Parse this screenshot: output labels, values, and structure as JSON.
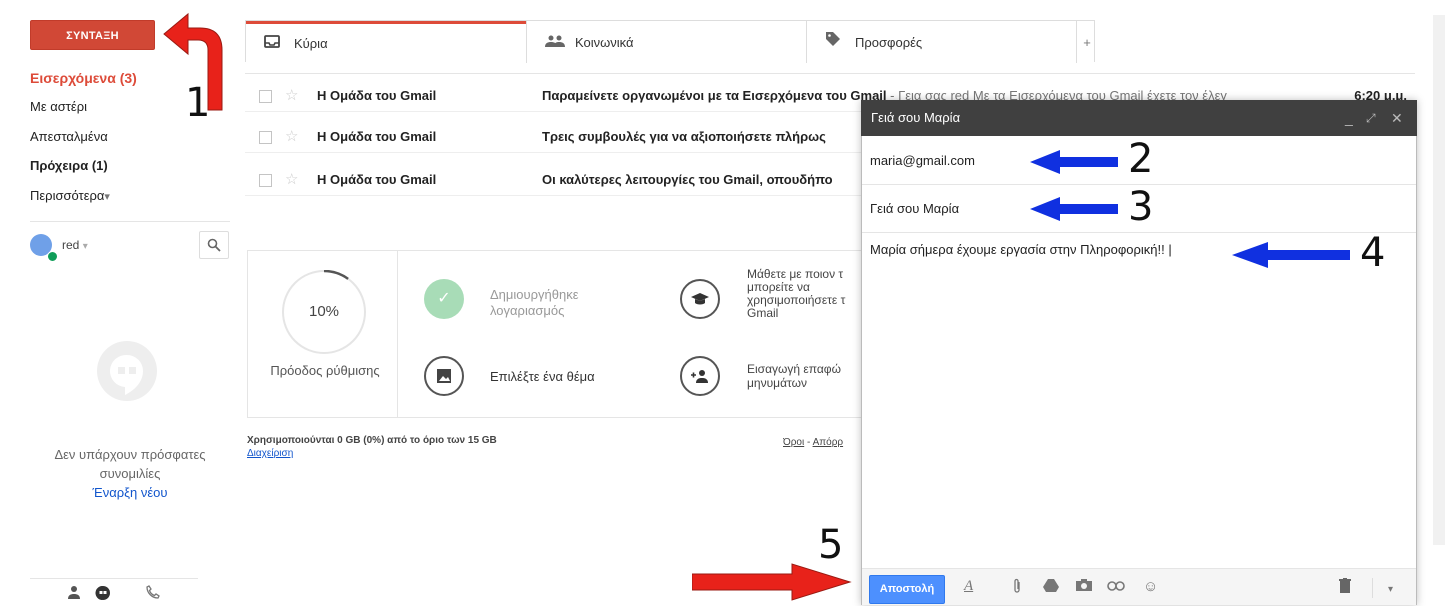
{
  "sidebar": {
    "compose_label": "ΣΥΝΤΑΞΗ",
    "items": [
      {
        "label": "Εισερχόμενα (3)"
      },
      {
        "label": "Με αστέρι"
      },
      {
        "label": "Απεσταλμένα"
      },
      {
        "label": "Πρόχειρα (1)"
      },
      {
        "label": "Περισσότερα"
      }
    ],
    "more_caret": "▾",
    "user": {
      "name": "red",
      "caret": "▾"
    },
    "no_conversations": "Δεν υπάρχουν πρόσφατες συνομιλίες",
    "new_conversation": "Έναρξη νέου"
  },
  "tabs": [
    {
      "label": "Κύρια",
      "icon": "inbox-icon"
    },
    {
      "label": "Κοινωνικά",
      "icon": "people-icon"
    },
    {
      "label": "Προσφορές",
      "icon": "tag-icon"
    },
    {
      "label": "+"
    }
  ],
  "emails": [
    {
      "sender": "Η Ομάδα του Gmail",
      "subject": "Παραμείνετε οργανωμένοι με τα Εισερχόμενα του Gmail",
      "snippet": " - Γεια σας red Με τα Εισερχόμενα του Gmail έχετε τον έλεγ",
      "time": "6:20 μ.μ."
    },
    {
      "sender": "Η Ομάδα του Gmail",
      "subject": "Τρεις συμβουλές για να αξιοποιήσετε πλήρως",
      "snippet": "",
      "time": ""
    },
    {
      "sender": "Η Ομάδα του Gmail",
      "subject": "Οι καλύτερες λειτουργίες του Gmail, οπουδήπο",
      "snippet": "",
      "time": ""
    }
  ],
  "setup": {
    "progress": 0.1,
    "progress_text": "10%",
    "progress_label": "Πρόοδος ρύθμισης",
    "steps": [
      {
        "label": "Δημιουργήθηκε λογαριασμός",
        "icon": "check-icon",
        "done": true
      },
      {
        "label": "Επιλέξτε ένα θέμα",
        "icon": "image-icon",
        "done": false
      },
      {
        "label": "Μάθετε με ποιον τ μπορείτε να χρησιμοποιήσετε τ Gmail",
        "icon": "graduation-cap-icon",
        "done": false
      },
      {
        "label": "Εισαγωγή επαφώ μηνυμάτων",
        "icon": "add-contact-icon",
        "done": false
      }
    ]
  },
  "footer": {
    "storage": "Χρησιμοποιούνται 0 GB (0%) από το όριο των 15 GB",
    "manage": "Διαχείριση",
    "terms": "Όροι",
    "privacy": "Απόρρ"
  },
  "compose": {
    "title": "Γειά σου Μαρία",
    "to": "maria@gmail.com",
    "subject": "Γειά σου Μαρία",
    "body": "Μαρία σήμερα έχουμε εργασία στην Πληροφορική!! |",
    "send_label": "Αποστολή"
  },
  "annotations": [
    "1",
    "2",
    "3",
    "4",
    "5"
  ],
  "colors": {
    "compose_red": "#d14836",
    "send_blue": "#4d90fe",
    "arrow_red": "#e8221a",
    "arrow_blue": "#1030e0"
  }
}
